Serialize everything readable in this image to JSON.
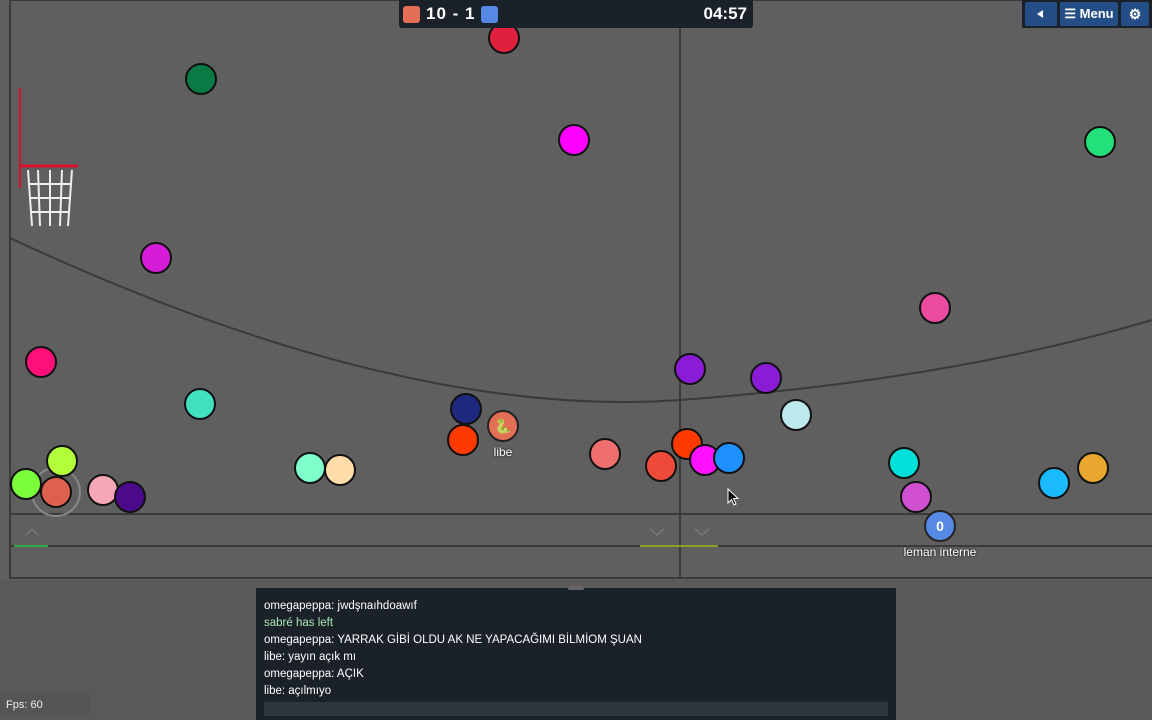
{
  "scoreboard": {
    "red_color": "#e56e56",
    "blue_color": "#5689e5",
    "score": "10 - 1",
    "timer": "04:57"
  },
  "menu": {
    "sound_icon": "speaker-icon",
    "menu_label": "☰ Menu",
    "settings_icon": "gear-icon"
  },
  "players": {
    "libe": {
      "name": "libe",
      "avatar": "🐍",
      "color": "#e56e56"
    },
    "leman": {
      "name": "leman interne",
      "avatar": "0",
      "color": "#5689e5"
    }
  },
  "chat": {
    "messages": [
      {
        "text": "omegapeppa: jwdşnaıhdoawıf",
        "type": "chat"
      },
      {
        "text": "sabré has left",
        "type": "system"
      },
      {
        "text": "omegapeppa: YARRAK GİBİ OLDU AK NE YAPACAĞIMI BİLMİOM ŞUAN",
        "type": "chat"
      },
      {
        "text": "libe: yayın açık mı",
        "type": "chat"
      },
      {
        "text": "omegapeppa: AÇIK",
        "type": "chat"
      },
      {
        "text": "libe: açılmıyo",
        "type": "chat"
      }
    ],
    "input_value": ""
  },
  "fps": "Fps: 60",
  "balls": [
    {
      "color": "#e0203f"
    },
    {
      "color": "#0a7a45"
    },
    {
      "color": "#ff00ff"
    },
    {
      "color": "#22e07a"
    },
    {
      "color": "#d61cd6"
    },
    {
      "color": "#ff0f7a"
    },
    {
      "color": "#ea4aa0"
    },
    {
      "color": "#40e0c0"
    },
    {
      "color": "#1e2a80"
    },
    {
      "color": "#ff3a00"
    },
    {
      "color": "#8a1cd6"
    },
    {
      "color": "#8a1cd6"
    },
    {
      "color": "#bde8ec"
    },
    {
      "color": "#f07070"
    },
    {
      "color": "#ff3a00"
    },
    {
      "color": "#ee4a3a"
    },
    {
      "color": "#ff10ff"
    },
    {
      "color": "#1e90ff"
    },
    {
      "color": "#00e0d8"
    },
    {
      "color": "#d050d0"
    },
    {
      "color": "#1abaff"
    },
    {
      "color": "#e8a830"
    },
    {
      "color": "#7cff3a"
    },
    {
      "color": "#b2ff3a"
    },
    {
      "color": "#e06050"
    },
    {
      "color": "#f7a8b8"
    },
    {
      "color": "#4a0a8a"
    },
    {
      "color": "#80ffcc"
    },
    {
      "color": "#ffdca8"
    }
  ]
}
